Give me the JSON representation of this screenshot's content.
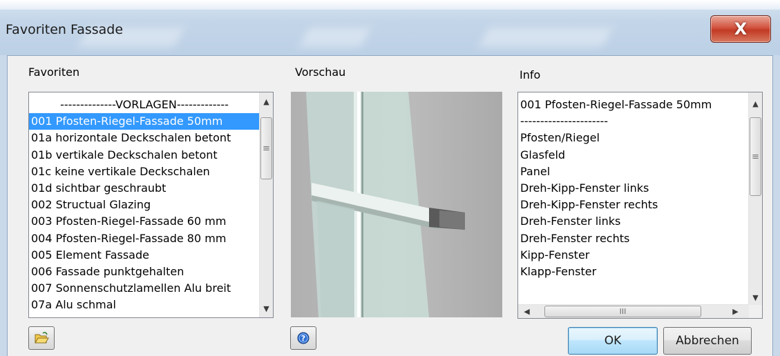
{
  "window": {
    "title": "Favoriten Fassade",
    "close_label": "X"
  },
  "favorites": {
    "label": "Favoriten",
    "items": [
      "--------------VORLAGEN-------------",
      "001 Pfosten-Riegel-Fassade  50mm",
      "01a horizontale Deckschalen betont",
      "01b vertikale Deckschalen betont",
      "01c keine vertikale Deckschalen",
      "01d sichtbar geschraubt",
      "002 Structual Glazing",
      "003 Pfosten-Riegel-Fassade 60 mm",
      "004 Pfosten-Riegel-Fassade 80 mm",
      "005 Element Fassade",
      "006 Fassade punktgehalten",
      "007 Sonnenschutzlamellen Alu breit",
      "07a Alu schmal"
    ],
    "selected_index": 1
  },
  "preview": {
    "label": "Vorschau"
  },
  "info": {
    "label": "Info",
    "items": [
      "001 Pfosten-Riegel-Fassade  50mm",
      "----------------------",
      "Pfosten/Riegel",
      "Glasfeld",
      "Panel",
      "Dreh-Kipp-Fenster links",
      "Dreh-Kipp-Fenster rechts",
      "Dreh-Fenster links",
      "Dreh-Fenster rechts",
      "Kipp-Fenster",
      "Klapp-Fenster"
    ],
    "thumb_grip": "III"
  },
  "buttons": {
    "ok": "OK",
    "cancel": "Abbrechen"
  },
  "icons": {
    "open_folder": "folder-open-icon",
    "help": "help-icon",
    "close": "close-icon"
  },
  "colors": {
    "selection": "#3399ff",
    "close_button": "#c23a24"
  }
}
